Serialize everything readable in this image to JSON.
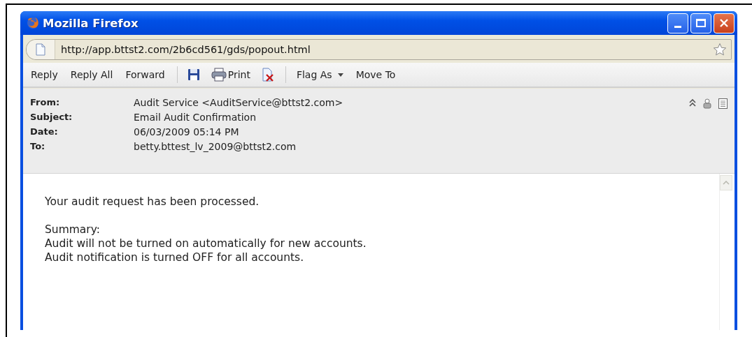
{
  "window": {
    "title": "Mozilla Firefox"
  },
  "address_bar": {
    "url": "http://app.bttst2.com/2b6cd561/gds/popout.html"
  },
  "toolbar": [
    {
      "kind": "text",
      "label": "Reply"
    },
    {
      "kind": "text",
      "label": "Reply All"
    },
    {
      "kind": "text",
      "label": "Forward"
    },
    {
      "kind": "separator"
    },
    {
      "kind": "save"
    },
    {
      "kind": "print",
      "label": "Print"
    },
    {
      "kind": "delete"
    },
    {
      "kind": "separator"
    },
    {
      "kind": "menu",
      "label": "Flag As"
    },
    {
      "kind": "text",
      "label": "Move To"
    }
  ],
  "header": [
    {
      "label": "From:",
      "value": "Audit Service <AuditService@bttst2.com>"
    },
    {
      "label": "Subject:",
      "value": "Email Audit Confirmation"
    },
    {
      "label": "Date:",
      "value": "06/03/2009 05:14 PM"
    },
    {
      "label": "To:",
      "value": "betty.bttest_lv_2009@bttst2.com"
    }
  ],
  "body": [
    [
      "Your audit request has been processed."
    ],
    [
      "Summary:",
      "Audit will not be turned on automatically for new accounts.",
      "Audit notification is turned OFF for all accounts."
    ]
  ]
}
